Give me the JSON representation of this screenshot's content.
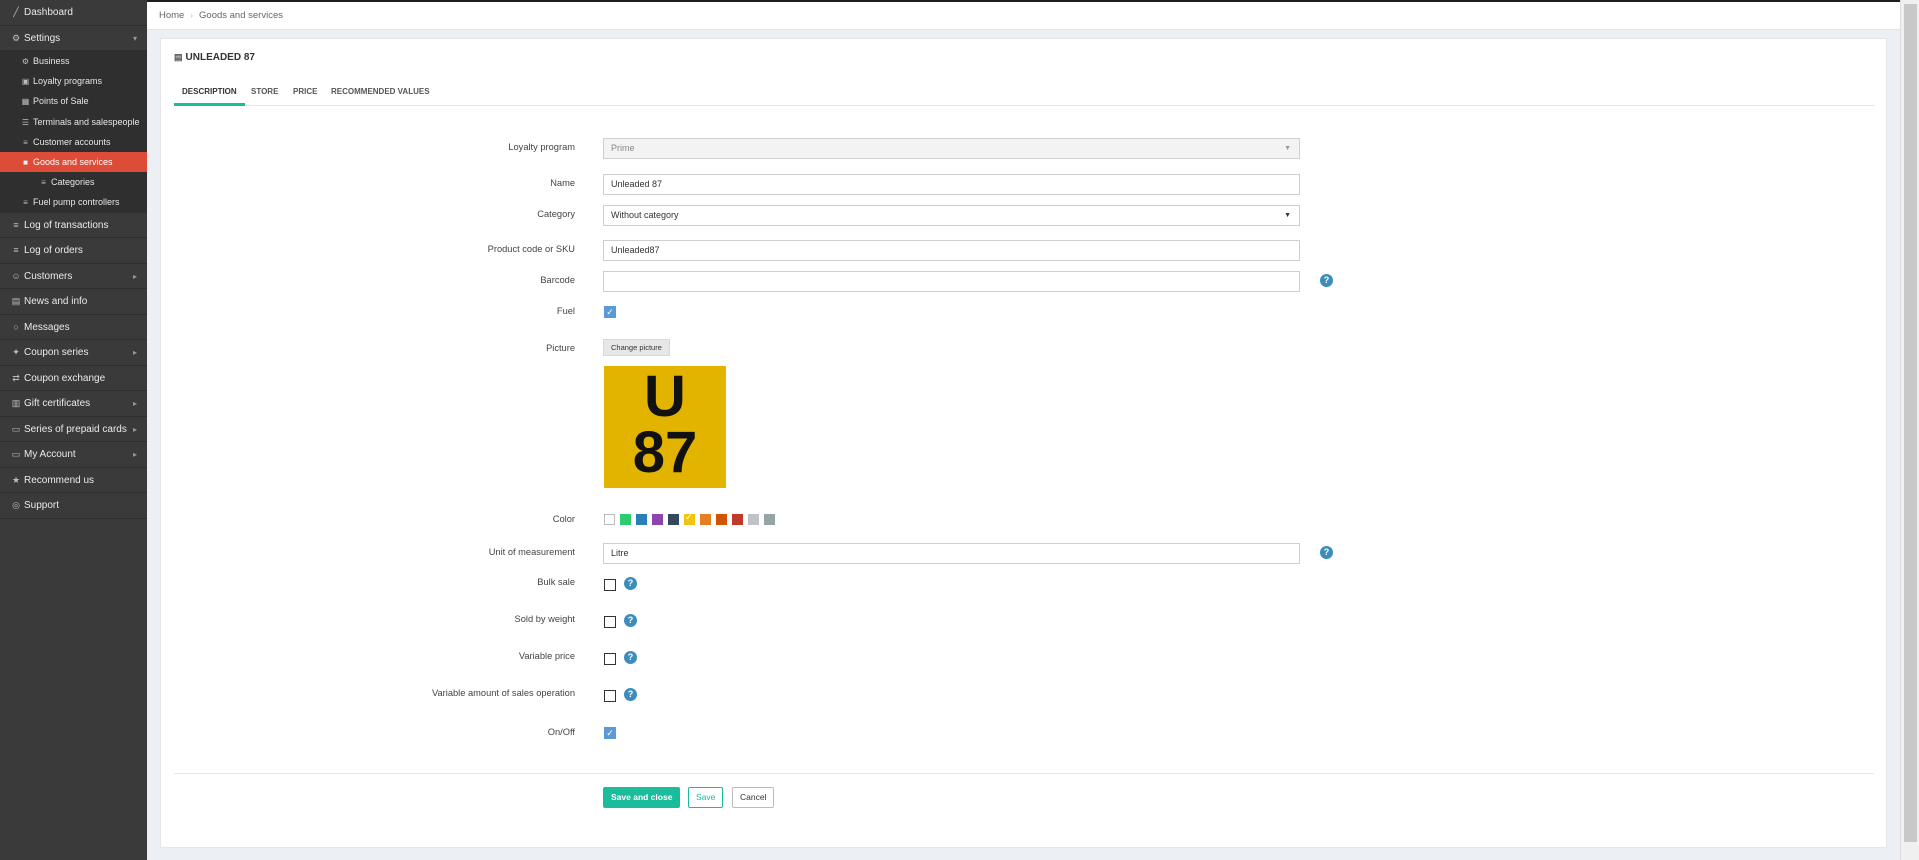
{
  "sidebar": {
    "dashboard": "Dashboard",
    "settings": "Settings",
    "settings_sub": {
      "business": "Business",
      "loyalty_programs": "Loyalty programs",
      "points_of_sale": "Points of Sale",
      "terminals": "Terminals and salespeople",
      "customer_accounts": "Customer accounts",
      "goods_and_services": "Goods and services",
      "categories": "Categories",
      "fuel_pump_controllers": "Fuel pump controllers"
    },
    "log_transactions": "Log of transactions",
    "log_orders": "Log of orders",
    "customers": "Customers",
    "news_info": "News and info",
    "messages": "Messages",
    "coupon_series": "Coupon series",
    "coupon_exchange": "Coupon exchange",
    "gift_certificates": "Gift certificates",
    "prepaid_cards": "Series of prepaid cards",
    "my_account": "My Account",
    "recommend_us": "Recommend us",
    "support": "Support"
  },
  "breadcrumb": {
    "home": "Home",
    "current": "Goods and services"
  },
  "card": {
    "title": "UNLEADED 87"
  },
  "tabs": {
    "description": "DESCRIPTION",
    "store": "STORE",
    "price": "PRICE",
    "recommended": "RECOMMENDED VALUES"
  },
  "form": {
    "loyalty_program": {
      "label": "Loyalty program",
      "value": "Prime"
    },
    "name": {
      "label": "Name",
      "value": "Unleaded 87"
    },
    "category": {
      "label": "Category",
      "value": "Without category"
    },
    "sku": {
      "label": "Product code or SKU",
      "value": "Unleaded87"
    },
    "barcode": {
      "label": "Barcode",
      "value": ""
    },
    "fuel": {
      "label": "Fuel",
      "checked": true
    },
    "picture": {
      "label": "Picture",
      "change_button": "Change picture",
      "image_line1": "U",
      "image_line2": "87",
      "image_bg": "#e2b400"
    },
    "color": {
      "label": "Color",
      "swatches": [
        "#ffffff",
        "#2ecc71",
        "#2980b9",
        "#8e44ad",
        "#34495e",
        "#f1c40f",
        "#e67e22",
        "#d35400",
        "#c0392b",
        "#bdc3c7",
        "#95a5a6"
      ],
      "selected_index": 5
    },
    "unit": {
      "label": "Unit of measurement",
      "value": "Litre"
    },
    "bulk_sale": {
      "label": "Bulk sale",
      "checked": false
    },
    "sold_by_weight": {
      "label": "Sold by weight",
      "checked": false
    },
    "variable_price": {
      "label": "Variable price",
      "checked": false
    },
    "variable_amount": {
      "label": "Variable amount of sales operation",
      "checked": false
    },
    "on_off": {
      "label": "On/Off",
      "checked": true
    }
  },
  "help_icon": "?",
  "buttons": {
    "save_and_close": "Save and close",
    "save": "Save",
    "cancel": "Cancel"
  },
  "colors": {
    "accent": "#1abc9c",
    "active_nav": "#dd4b39",
    "sidebar_bg": "#3a3a3a",
    "help_blue": "#3c8dbc"
  }
}
